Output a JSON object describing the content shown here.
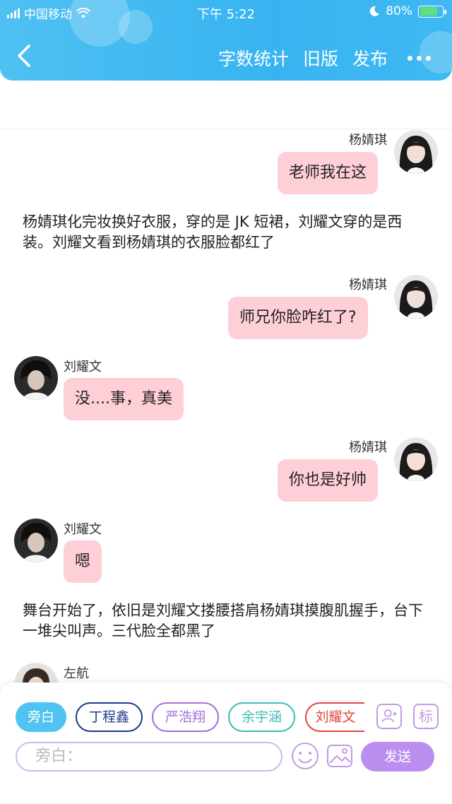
{
  "status_bar": {
    "carrier": "中国移动",
    "time": "下午 5:22",
    "battery": "80%"
  },
  "nav": {
    "word_count": "字数统计",
    "old_version": "旧版",
    "publish": "发布"
  },
  "messages": {
    "m1": {
      "name": "杨婧琪",
      "text": "老师我在这"
    },
    "n1": {
      "text": "杨婧琪化完妆换好衣服，穿的是 JK 短裙，刘耀文穿的是西装。刘耀文看到杨婧琪的衣服脸都红了"
    },
    "m2": {
      "name": "杨婧琪",
      "text": "师兄你脸咋红了?"
    },
    "m3": {
      "name": "刘耀文",
      "text": "没....事，真美"
    },
    "m4": {
      "name": "杨婧琪",
      "text": "你也是好帅"
    },
    "m5": {
      "name": "刘耀文",
      "text": "嗯"
    },
    "n2": {
      "text": "舞台开始了，依旧是刘耀文搂腰搭肩杨婧琪摸腹肌握手，台下一堆尖叫声。三代脸全都黑了"
    },
    "m6": {
      "name": "左航"
    }
  },
  "roles": {
    "narrator": "旁白",
    "r1": "丁程鑫",
    "r2": "严浩翔",
    "r3": "余宇涵",
    "r4": "刘耀文",
    "tag_icon_text": "标"
  },
  "composer": {
    "placeholder": "旁白：",
    "send": "发送"
  },
  "colors": {
    "header": "#37b4f0",
    "bubble": "#ffcfd8",
    "send": "#bb8ff0"
  }
}
